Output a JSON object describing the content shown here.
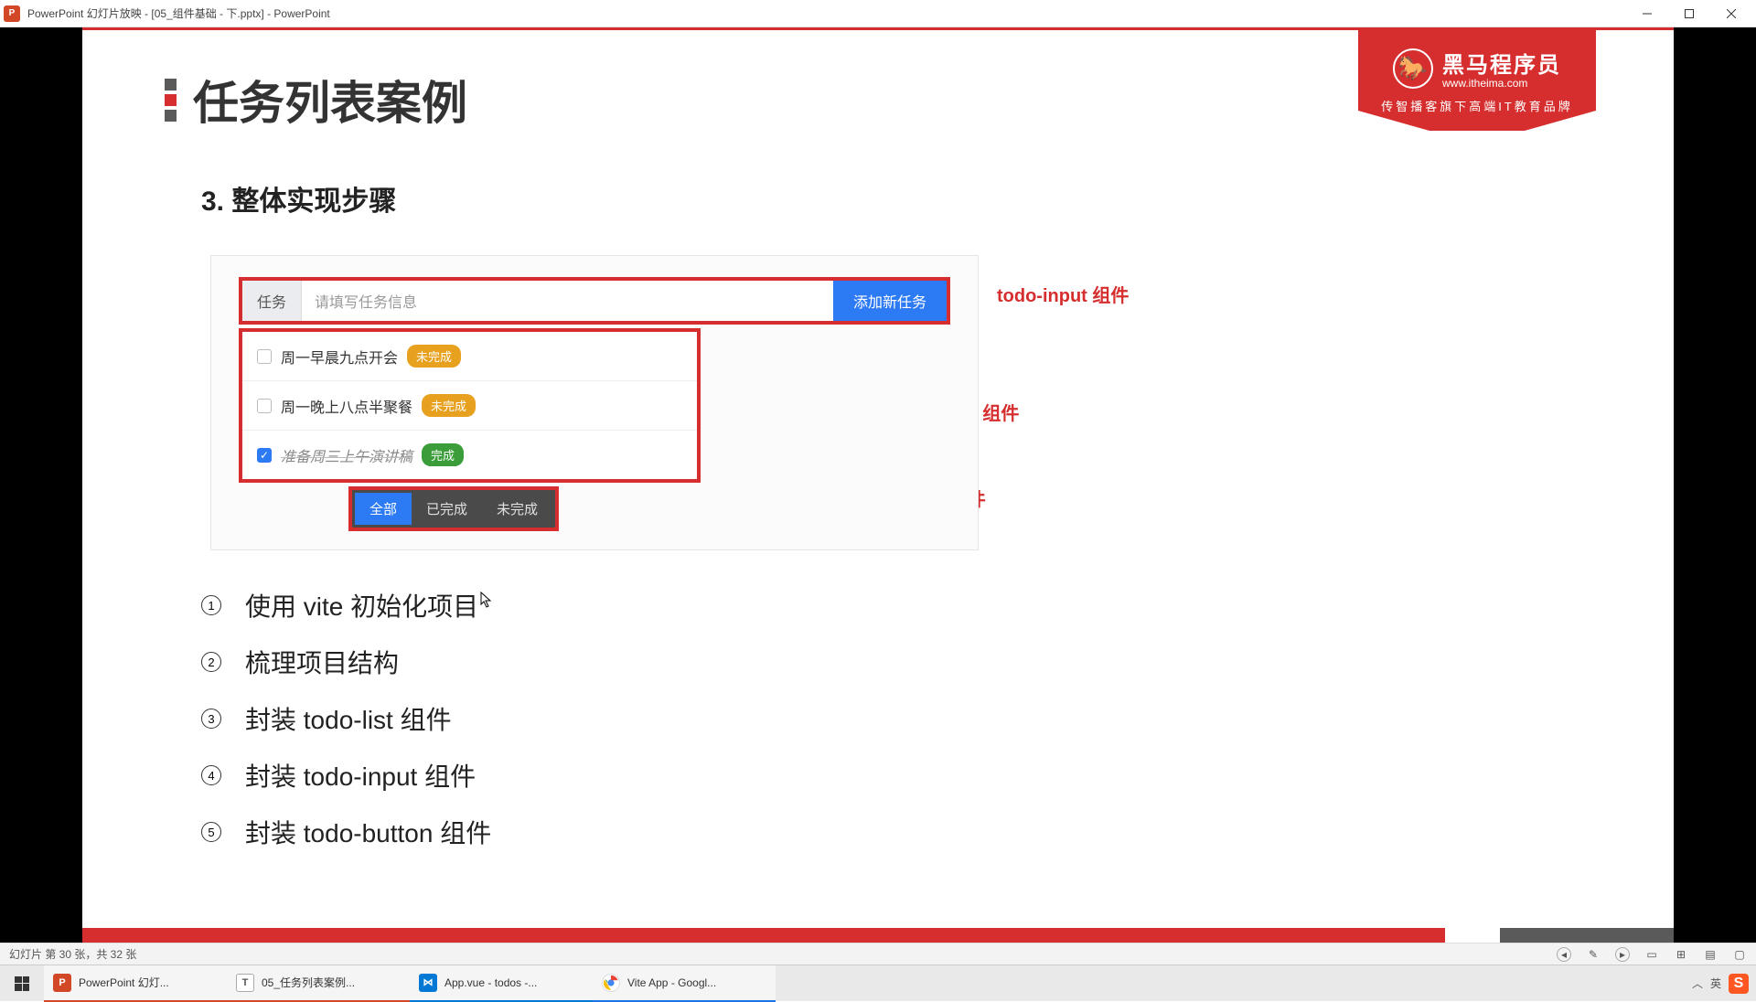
{
  "titlebar": {
    "appIconText": "P",
    "title": "PowerPoint 幻灯片放映 - [05_组件基础 - 下.pptx] - PowerPoint"
  },
  "slide": {
    "title": "任务列表案例",
    "brand": {
      "name": "黑马程序员",
      "url": "www.itheima.com",
      "sub": "传智播客旗下高端IT教育品牌"
    },
    "section": "3. 整体实现步骤",
    "mockup": {
      "inputLabel": "任务",
      "inputPlaceholder": "请填写任务信息",
      "addBtn": "添加新任务",
      "items": [
        {
          "text": "周一早晨九点开会",
          "done": false,
          "badge": "未完成",
          "badgeType": "warn"
        },
        {
          "text": "周一晚上八点半聚餐",
          "done": false,
          "badge": "未完成",
          "badgeType": "warn"
        },
        {
          "text": "准备周三上午演讲稿",
          "done": true,
          "badge": "完成",
          "badgeType": "ok"
        }
      ],
      "filters": {
        "all": "全部",
        "done": "已完成",
        "undone": "未完成"
      },
      "annotations": {
        "input": "todo-input 组件",
        "list": "todo-list 组件",
        "button": "todo-button 组件"
      }
    },
    "steps": [
      "使用 vite 初始化项目",
      "梳理项目结构",
      "封装 todo-list 组件",
      "封装 todo-input 组件",
      "封装 todo-button 组件"
    ]
  },
  "statusbar": {
    "left": "幻灯片 第 30 张，共 32 张"
  },
  "taskbar": {
    "items": [
      {
        "icon": "pp",
        "iconText": "P",
        "label": "PowerPoint 幻灯..."
      },
      {
        "icon": "txt",
        "iconText": "T",
        "label": "05_任务列表案例..."
      },
      {
        "icon": "vs",
        "iconText": "⋈",
        "label": "App.vue - todos -..."
      },
      {
        "icon": "ch",
        "iconText": "",
        "label": "Vite App - Googl..."
      }
    ],
    "tray": {
      "ime": "英",
      "sogou": "S"
    }
  }
}
